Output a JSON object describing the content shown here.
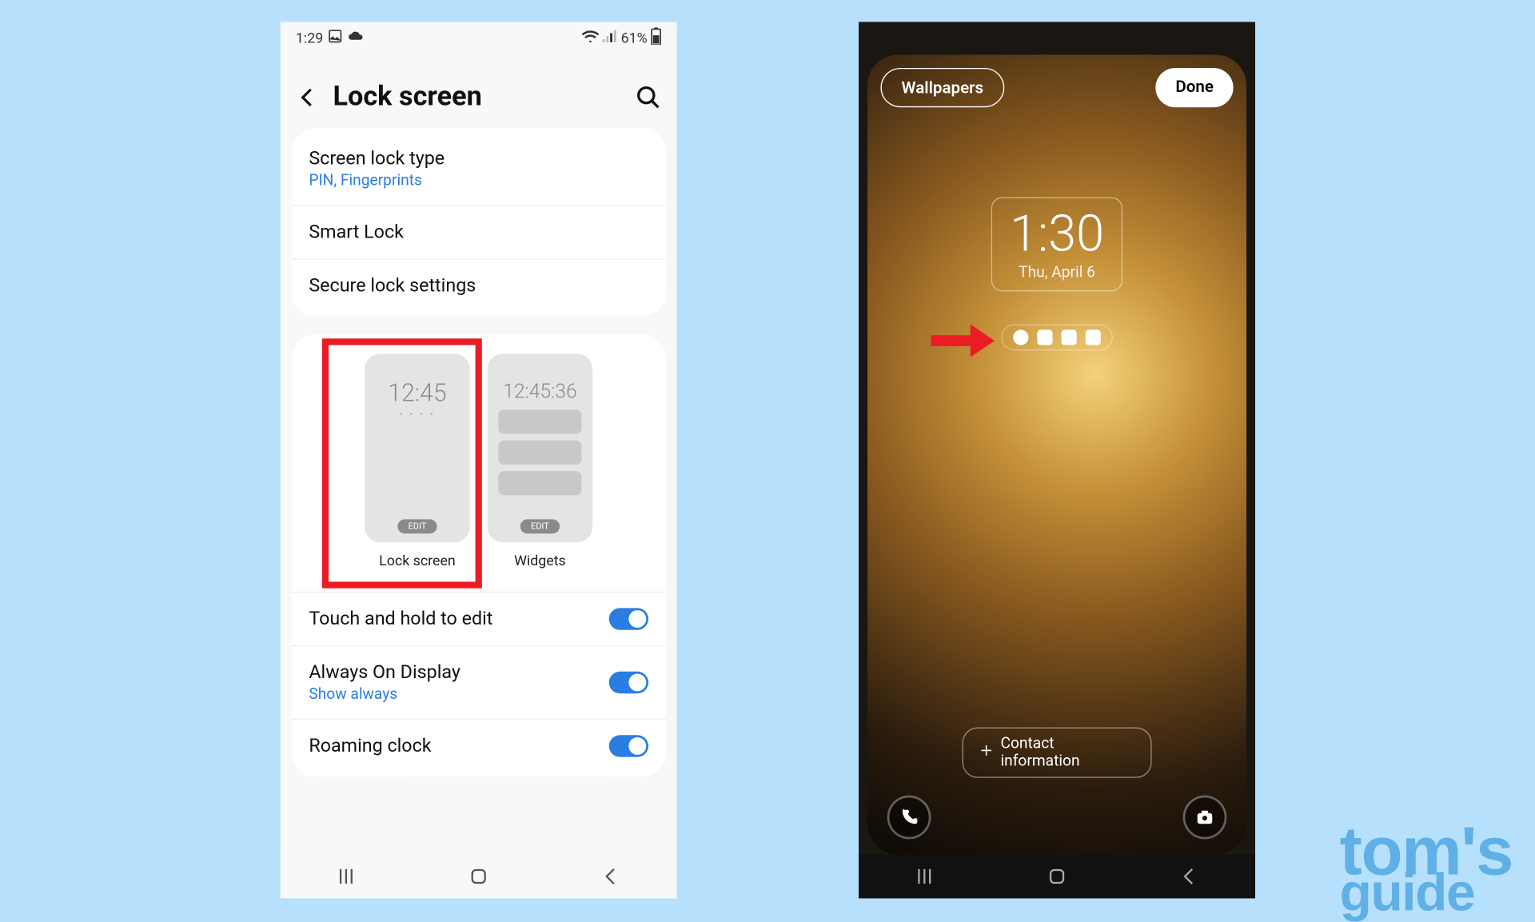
{
  "statusbar": {
    "time": "1:29",
    "battery": "61%"
  },
  "header": {
    "title": "Lock screen"
  },
  "card1": {
    "screen_lock_type": {
      "label": "Screen lock type",
      "sub": "PIN, Fingerprints"
    },
    "smart_lock": {
      "label": "Smart Lock"
    },
    "secure_lock": {
      "label": "Secure lock settings"
    }
  },
  "previews": {
    "lock": {
      "time": "12:45",
      "dots": "• • • •",
      "edit": "EDIT",
      "label": "Lock screen"
    },
    "widgets": {
      "time": "12:45:36",
      "edit": "EDIT",
      "label": "Widgets"
    }
  },
  "card3": {
    "touch_hold": {
      "label": "Touch and hold to edit"
    },
    "aod": {
      "label": "Always On Display",
      "sub": "Show always"
    },
    "roaming": {
      "label": "Roaming clock"
    }
  },
  "editor": {
    "wallpapers": "Wallpapers",
    "done": "Done",
    "clock_time": "1:30",
    "clock_date": "Thu, April 6",
    "contact_info": "Contact information"
  },
  "watermark": {
    "l1": "tom's",
    "l2": "guide"
  }
}
